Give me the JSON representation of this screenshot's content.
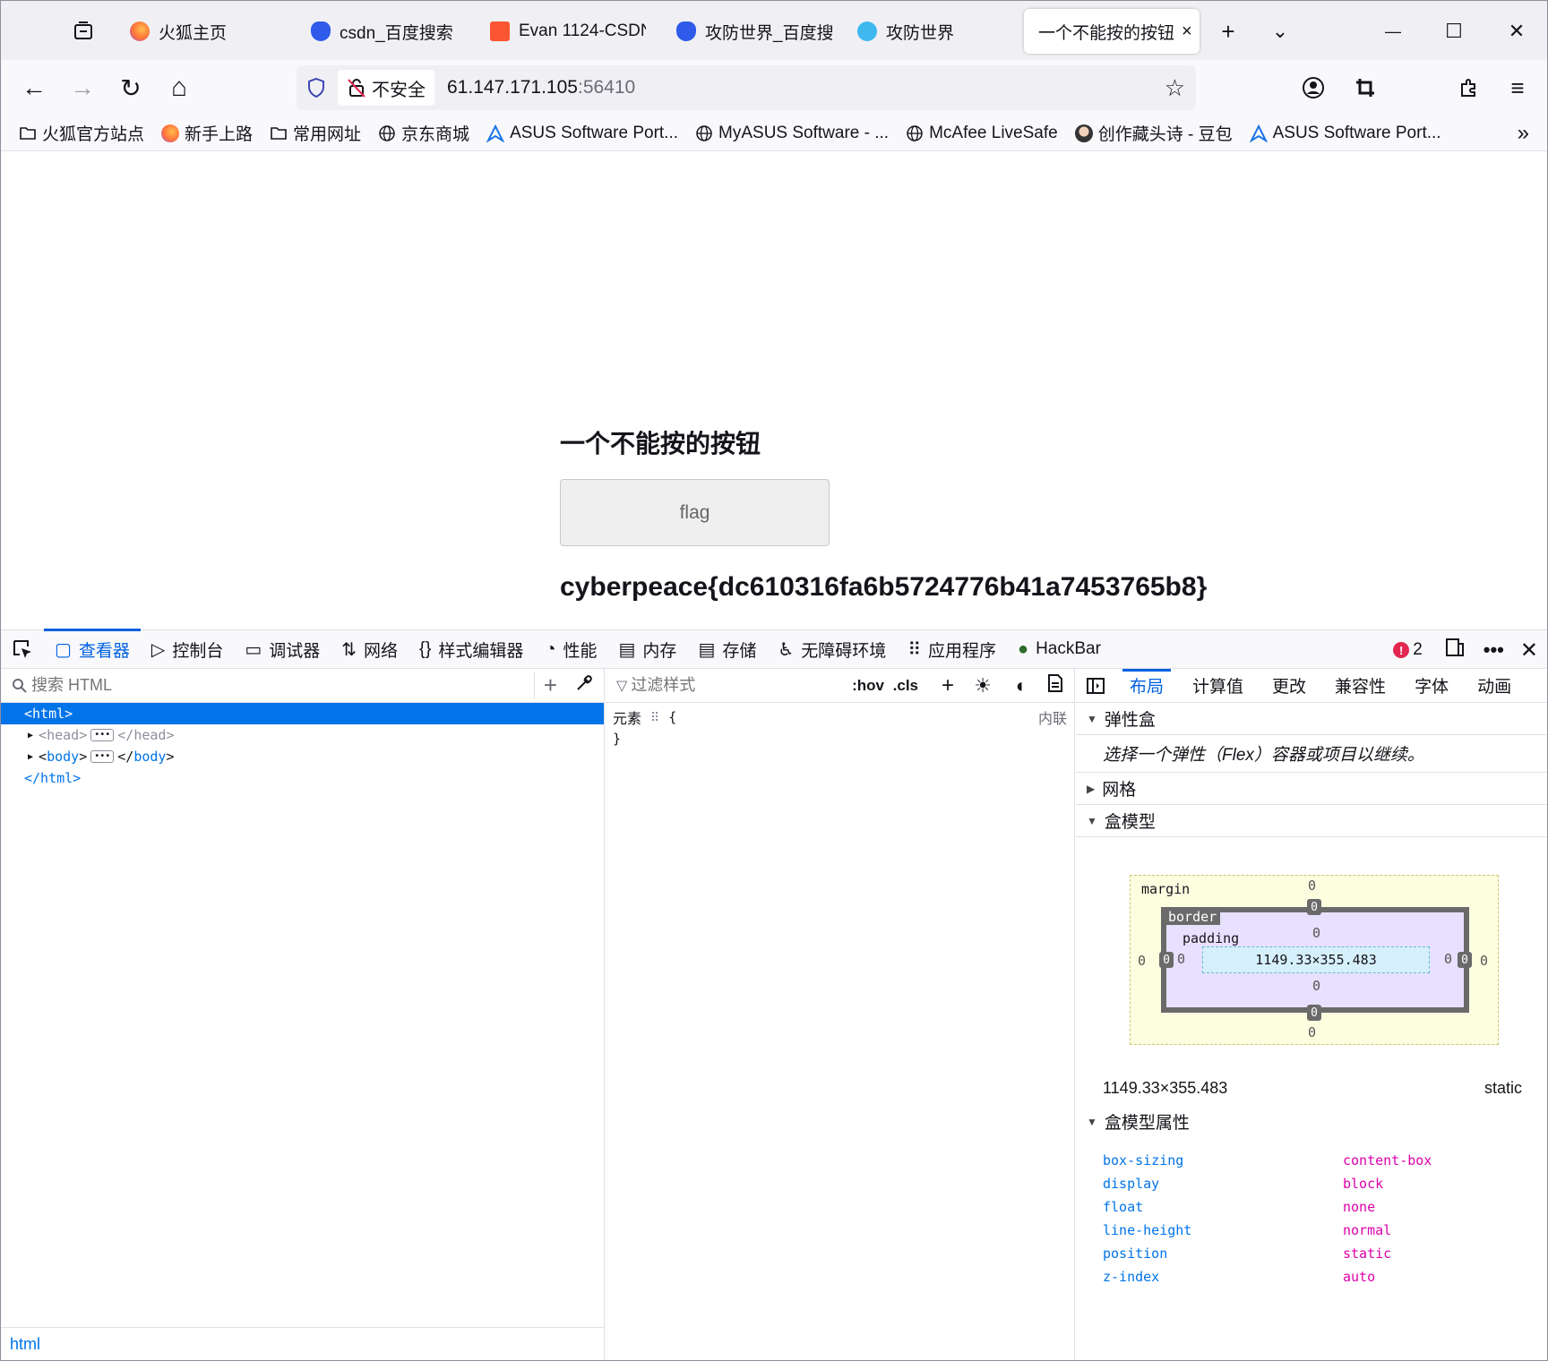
{
  "browser": {
    "tabs": [
      {
        "label": "火狐主页",
        "color": "#ff7139"
      },
      {
        "label": "csdn_百度搜索",
        "color": "#2f5bea"
      },
      {
        "label": "Evan 1124-CSDN",
        "color": "#fc5531"
      },
      {
        "label": "攻防世界_百度搜",
        "color": "#2f5bea"
      },
      {
        "label": "攻防世界",
        "color": "#3fb8f0"
      },
      {
        "label": "一个不能按的按钮",
        "color": "",
        "active": true
      }
    ],
    "tab_close": "×",
    "new_tab": "+",
    "tab_list": "⌄",
    "win_min": "—",
    "win_max": "☐",
    "win_close": "✕",
    "nav": {
      "back": "←",
      "forward": "→",
      "reload": "↻",
      "home": "⌂"
    },
    "insecure_label": "不安全",
    "url_host": "61.147.171.105",
    "url_port": ":56410",
    "star": "☆",
    "bookmarks": [
      {
        "label": "火狐官方站点",
        "icon": "folder-icon"
      },
      {
        "label": "新手上路",
        "icon": "firefox-icon"
      },
      {
        "label": "常用网址",
        "icon": "folder-icon"
      },
      {
        "label": "京东商城",
        "icon": "globe-icon"
      },
      {
        "label": "ASUS Software Port...",
        "icon": "asus-icon"
      },
      {
        "label": "MyASUS Software - ...",
        "icon": "globe-icon"
      },
      {
        "label": "McAfee LiveSafe",
        "icon": "globe-icon"
      },
      {
        "label": "创作藏头诗 - 豆包",
        "icon": "avatar-icon"
      },
      {
        "label": "ASUS Software Port...",
        "icon": "asus-icon"
      }
    ],
    "bookmarks_more": "»"
  },
  "page": {
    "heading": "一个不能按的按钮",
    "button_label": "flag",
    "flag_text": "cyberpeace{dc610316fa6b5724776b41a7453765b8}"
  },
  "devtools": {
    "tools": [
      {
        "label": "查看器",
        "icon": "▢",
        "selected": true
      },
      {
        "label": "控制台",
        "icon": "▷"
      },
      {
        "label": "调试器",
        "icon": "▭"
      },
      {
        "label": "网络",
        "icon": "⇅"
      },
      {
        "label": "样式编辑器",
        "icon": "{}"
      },
      {
        "label": "性能",
        "icon": "◔"
      },
      {
        "label": "内存",
        "icon": "▤"
      },
      {
        "label": "存储",
        "icon": "▤"
      },
      {
        "label": "无障碍环境",
        "icon": "♿"
      },
      {
        "label": "应用程序",
        "icon": "⠿"
      },
      {
        "label": "HackBar",
        "icon": "●"
      }
    ],
    "error_count": "2",
    "search_placeholder": "搜索 HTML",
    "tree": {
      "html_open": "<html>",
      "head": "head",
      "body": "body",
      "html_close": "</html>"
    },
    "breadcrumb": "html",
    "filter_placeholder": "过滤样式",
    "hov": ":hov",
    "cls": ".cls",
    "rule_selector": "元素",
    "rule_open": "{",
    "rule_close": "}",
    "rule_source": "内联",
    "layout_tabs": [
      "布局",
      "计算值",
      "更改",
      "兼容性",
      "字体",
      "动画"
    ],
    "flexbox_title": "弹性盒",
    "flexbox_hint": "选择一个弹性（Flex）容器或项目以继续。",
    "grid_title": "网格",
    "boxmodel_title": "盒模型",
    "bm": {
      "margin": "margin",
      "border": "border",
      "padding": "padding",
      "size": "1149.33×355.483",
      "zero": "0"
    },
    "dimensions": "1149.33×355.483",
    "position_value": "static",
    "props_title": "盒模型属性",
    "props": [
      {
        "k": "box-sizing",
        "v": "content-box"
      },
      {
        "k": "display",
        "v": "block"
      },
      {
        "k": "float",
        "v": "none"
      },
      {
        "k": "line-height",
        "v": "normal"
      },
      {
        "k": "position",
        "v": "static"
      },
      {
        "k": "z-index",
        "v": "auto"
      }
    ]
  }
}
